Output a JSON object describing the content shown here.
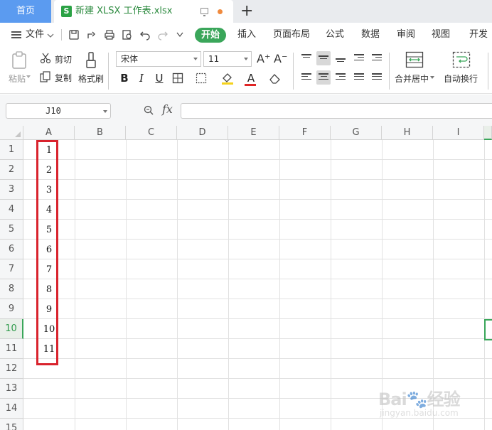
{
  "window": {
    "home_tab": "首页",
    "doc_icon": "S",
    "doc_title": "新建 XLSX 工作表.xlsx",
    "new_tab_symbol": "+"
  },
  "menubar": {
    "file_label": "文件",
    "active_tab": "开始",
    "tabs": [
      "插入",
      "页面布局",
      "公式",
      "数据",
      "审阅",
      "视图",
      "开发工"
    ]
  },
  "ribbon": {
    "paste_label": "粘贴",
    "cut_label": "剪切",
    "copy_label": "复制",
    "format_painter_label": "格式刷",
    "font_name": "宋体",
    "font_size": "11",
    "bold": "B",
    "italic": "I",
    "underline": "U",
    "font_color_letter": "A",
    "grow_font": "A⁺",
    "shrink_font": "A⁻",
    "merge_label": "合并居中",
    "wrap_label": "自动换行"
  },
  "formula_bar": {
    "name_box": "J10",
    "fx_label": "fx",
    "formula": ""
  },
  "sheet": {
    "columns": [
      "A",
      "B",
      "C",
      "D",
      "E",
      "F",
      "G",
      "H",
      "I"
    ],
    "rows": [
      "1",
      "2",
      "3",
      "4",
      "5",
      "6",
      "7",
      "8",
      "9",
      "10",
      "11",
      "12",
      "13",
      "14",
      "15"
    ],
    "active_row": "10",
    "column_a_values": [
      "1",
      "2",
      "3",
      "4",
      "5",
      "6",
      "7",
      "8",
      "9",
      "10",
      "11"
    ]
  },
  "colors": {
    "accent_green": "#3aa65a",
    "home_tab_blue": "#5b9bf0",
    "highlight_red": "#d9232d"
  },
  "watermark": {
    "brand": "Bai🐾经验",
    "url": "jingyan.baidu.com"
  }
}
